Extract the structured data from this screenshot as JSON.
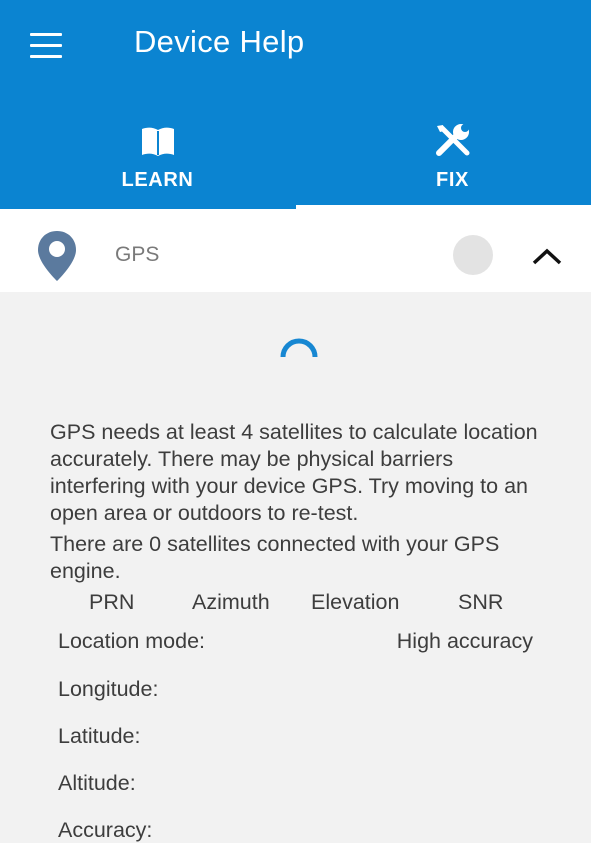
{
  "app": {
    "title": "Device Help",
    "icons": {
      "menu": "hamburger-menu-icon"
    }
  },
  "tabs": [
    {
      "label": "LEARN",
      "icon": "open-book-icon",
      "selected": false
    },
    {
      "label": "FIX",
      "icon": "tools-icon",
      "selected": true
    }
  ],
  "gps_row": {
    "label": "GPS",
    "icon": "location-pin-icon",
    "expanded": true,
    "expand_icon": "chevron-up-icon"
  },
  "messages": {
    "satellite_need": "GPS needs at least 4 satellites to calculate location accurately. There may be physical barriers interfering with your device GPS. Try moving to an open area or outdoors to re-test.",
    "satellites_connected": "There are 0 satellites connected with your GPS engine."
  },
  "satellite_table": {
    "columns": [
      "PRN",
      "Azimuth",
      "Elevation",
      "SNR"
    ]
  },
  "location_info": {
    "mode_label": "Location mode:",
    "mode_value": "High accuracy",
    "longitude_label": "Longitude:",
    "latitude_label": "Latitude:",
    "altitude_label": "Altitude:",
    "accuracy_label": "Accuracy:"
  },
  "colors": {
    "primary": "#0b84d1",
    "background": "#f2f2f2",
    "pin": "#5b7a9e",
    "spinner": "#1787d2"
  }
}
